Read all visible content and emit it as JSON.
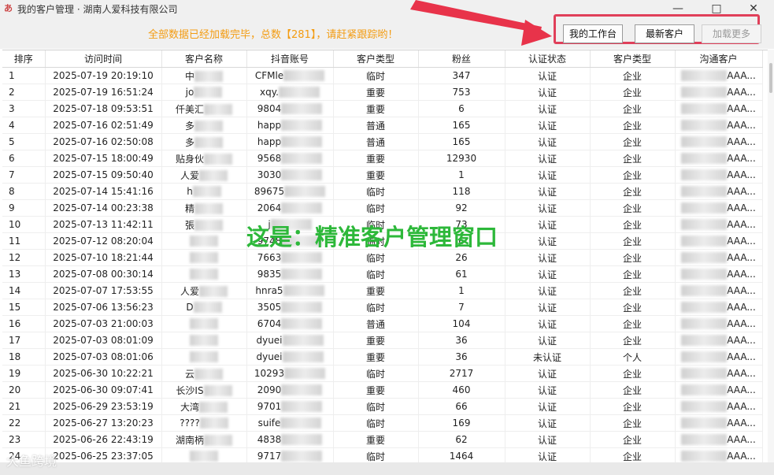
{
  "window": {
    "title": "我的客户管理 · 湖南人爱科技有限公司",
    "icon": "app-logo-icon"
  },
  "toolbar": {
    "status": "全部数据已经加载完毕，总数【281】，请赶紧跟踪哟！",
    "workbench_label": "我的工作台",
    "new_customers_label": "最新客户",
    "load_more_label": "加载更多"
  },
  "overlay_text": "这是：精准客户管理窗口",
  "watermark_text": "大鱼跨境",
  "colors": {
    "highlight_frame": "#e0405a",
    "arrow": "#e8334a",
    "status_text": "#f39c12",
    "overlay_text": "#2db83a"
  },
  "table": {
    "columns": [
      "排序",
      "访问时间",
      "客户名称",
      "抖音账号",
      "客户类型",
      "粉丝",
      "认证状态",
      "客户类型",
      "沟通客户"
    ],
    "rows": [
      [
        "1",
        "2025-07-19 20:19:10",
        "中",
        "CFMle",
        "临时",
        "347",
        "认证",
        "企业",
        "AAA..."
      ],
      [
        "2",
        "2025-07-19 16:51:24",
        "jo",
        "xqy.",
        "重要",
        "753",
        "认证",
        "企业",
        "AAA..."
      ],
      [
        "3",
        "2025-07-18 09:53:51",
        "仟美汇",
        "9804",
        "重要",
        "6",
        "认证",
        "企业",
        "AAA..."
      ],
      [
        "4",
        "2025-07-16 02:51:49",
        "多",
        "happ",
        "普通",
        "165",
        "认证",
        "企业",
        "AAA..."
      ],
      [
        "5",
        "2025-07-16 02:50:08",
        "多",
        "happ",
        "普通",
        "165",
        "认证",
        "企业",
        "AAA..."
      ],
      [
        "6",
        "2025-07-15 18:00:49",
        "贴身伙",
        "9568",
        "重要",
        "12930",
        "认证",
        "企业",
        "AAA..."
      ],
      [
        "7",
        "2025-07-15 09:50:40",
        "人爱",
        "3030",
        "重要",
        "1",
        "认证",
        "企业",
        "AAA..."
      ],
      [
        "8",
        "2025-07-14 15:41:16",
        "h",
        "89675",
        "临时",
        "118",
        "认证",
        "企业",
        "AAA..."
      ],
      [
        "9",
        "2025-07-14 00:23:38",
        "精",
        "2064",
        "临时",
        "92",
        "认证",
        "企业",
        "AAA..."
      ],
      [
        "10",
        "2025-07-13 11:42:11",
        "張",
        "j",
        "临时",
        "73",
        "认证",
        "企业",
        "AAA..."
      ],
      [
        "11",
        "2025-07-12 08:20:04",
        "",
        "9748",
        "临时",
        "6",
        "认证",
        "企业",
        "AAA..."
      ],
      [
        "12",
        "2025-07-10 18:21:44",
        "",
        "7663",
        "临时",
        "26",
        "认证",
        "企业",
        "AAA..."
      ],
      [
        "13",
        "2025-07-08 00:30:14",
        "",
        "9835",
        "临时",
        "61",
        "认证",
        "企业",
        "AAA..."
      ],
      [
        "14",
        "2025-07-07 17:53:55",
        "人爱",
        "hnra5",
        "重要",
        "1",
        "认证",
        "企业",
        "AAA..."
      ],
      [
        "15",
        "2025-07-06 13:56:23",
        "D",
        "3505",
        "临时",
        "7",
        "认证",
        "企业",
        "AAA..."
      ],
      [
        "16",
        "2025-07-03 21:00:03",
        "",
        "6704",
        "普通",
        "104",
        "认证",
        "企业",
        "AAA..."
      ],
      [
        "17",
        "2025-07-03 08:01:09",
        "",
        "dyuei",
        "重要",
        "36",
        "认证",
        "企业",
        "AAA..."
      ],
      [
        "18",
        "2025-07-03 08:01:06",
        "",
        "dyuei",
        "重要",
        "36",
        "未认证",
        "个人",
        "AAA..."
      ],
      [
        "19",
        "2025-06-30 10:22:21",
        "云",
        "10293",
        "临时",
        "2717",
        "认证",
        "企业",
        "AAA..."
      ],
      [
        "20",
        "2025-06-30 09:07:41",
        "长沙IS",
        "2090",
        "重要",
        "460",
        "认证",
        "企业",
        "AAA..."
      ],
      [
        "21",
        "2025-06-29 23:53:19",
        "大湾",
        "9701",
        "临时",
        "66",
        "认证",
        "企业",
        "AAA..."
      ],
      [
        "22",
        "2025-06-27 13:20:23",
        "????",
        "suife",
        "临时",
        "169",
        "认证",
        "企业",
        "AAA..."
      ],
      [
        "23",
        "2025-06-26 22:43:19",
        "湖南柄",
        "4838",
        "重要",
        "62",
        "认证",
        "企业",
        "AAA..."
      ],
      [
        "24",
        "2025-06-25 23:37:05",
        "",
        "9717",
        "临时",
        "1464",
        "认证",
        "企业",
        "AAA..."
      ]
    ]
  }
}
